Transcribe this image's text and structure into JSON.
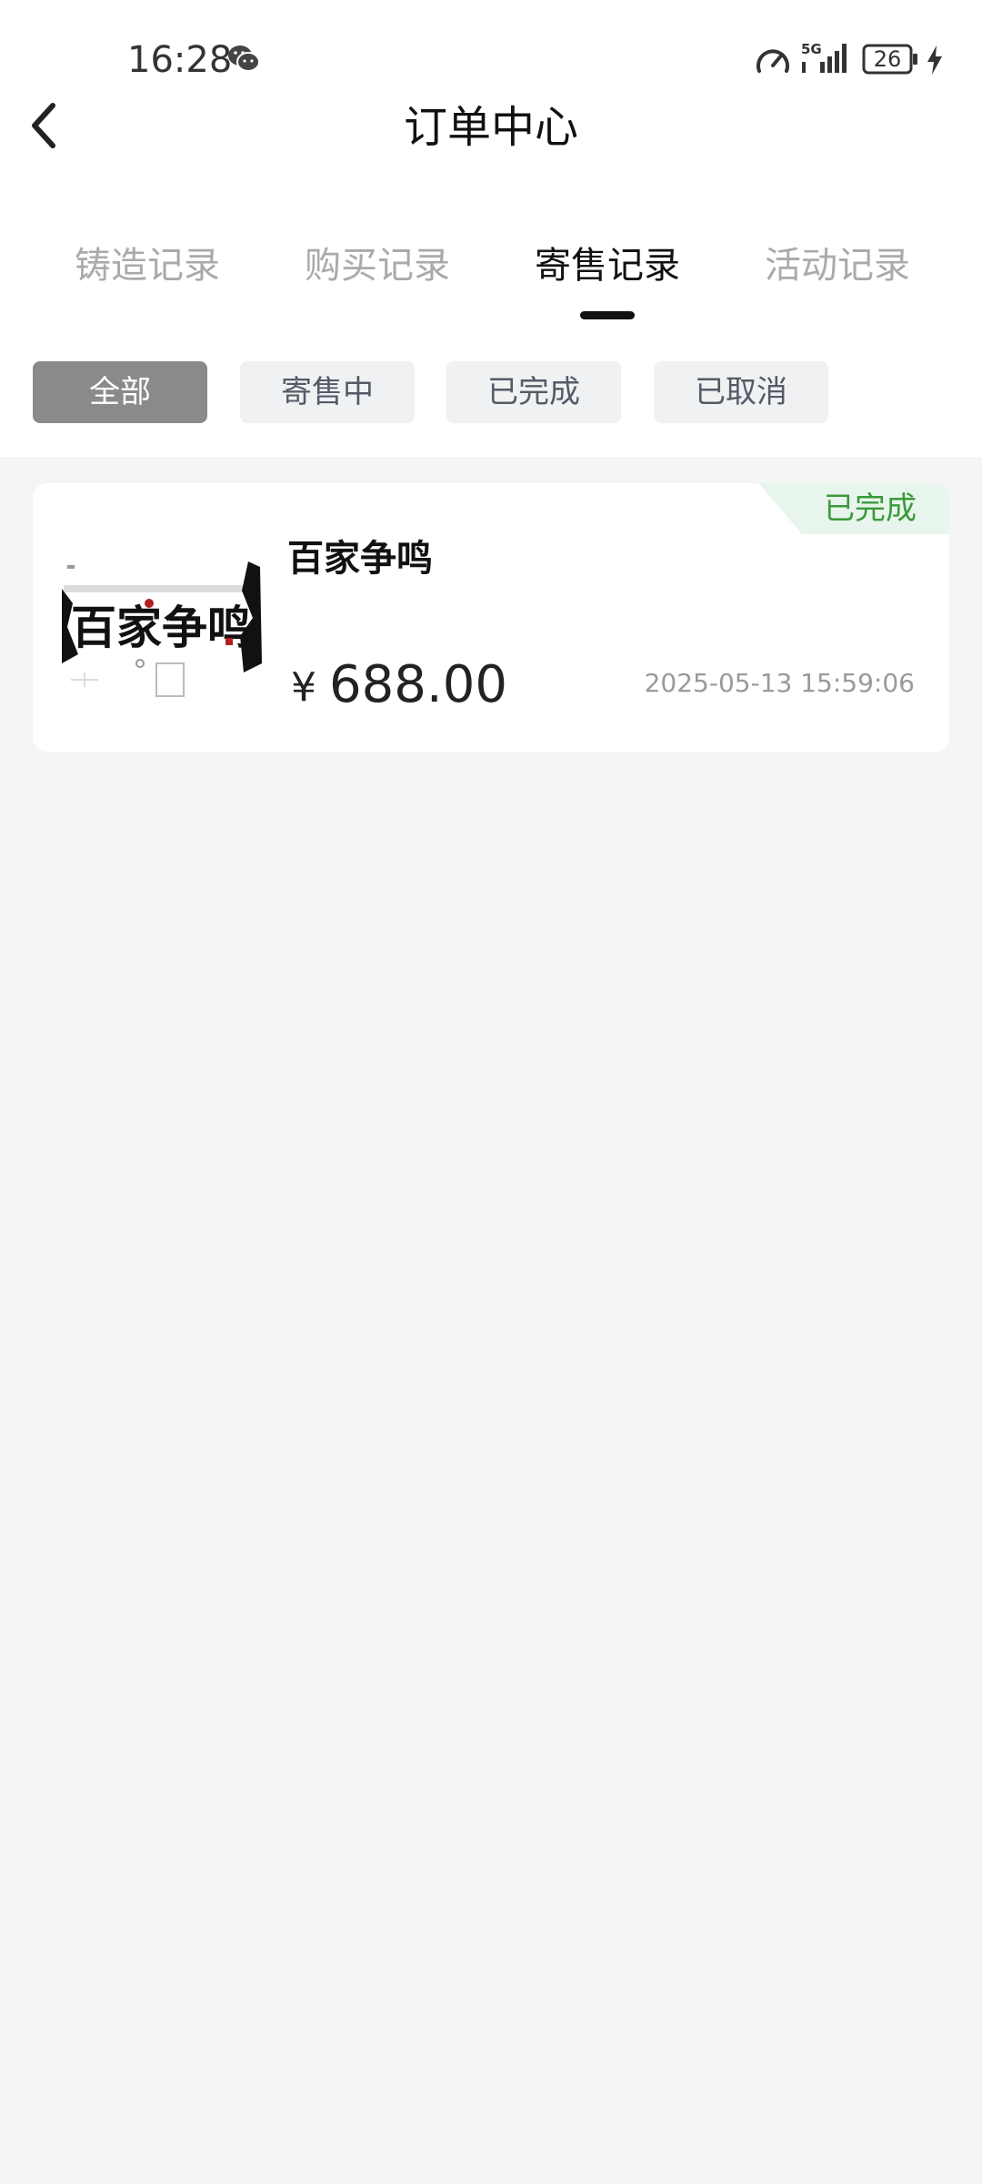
{
  "status_bar": {
    "time": "16:28",
    "network": "5G",
    "battery": "26"
  },
  "header": {
    "title": "订单中心"
  },
  "tabs": [
    {
      "label": "铸造记录",
      "active": false
    },
    {
      "label": "购买记录",
      "active": false
    },
    {
      "label": "寄售记录",
      "active": true
    },
    {
      "label": "活动记录",
      "active": false
    }
  ],
  "filters": [
    {
      "label": "全部",
      "selected": true
    },
    {
      "label": "寄售中",
      "selected": false
    },
    {
      "label": "已完成",
      "selected": false
    },
    {
      "label": "已取消",
      "selected": false
    }
  ],
  "orders": [
    {
      "status": "已完成",
      "name": "百家争鸣",
      "image_text": "百家争鸣",
      "currency": "¥",
      "price": "688.00",
      "time": "2025-05-13 15:59:06"
    }
  ],
  "colors": {
    "page_bg": "#f5f5f5",
    "chip_selected": "#8a8a8a",
    "status_done": "#3a9a3a",
    "status_done_bg": "#e8f5ec"
  },
  "icons": [
    "wechat-icon",
    "speed-icon",
    "signal-icon",
    "battery-icon",
    "charge-icon",
    "back-icon"
  ]
}
